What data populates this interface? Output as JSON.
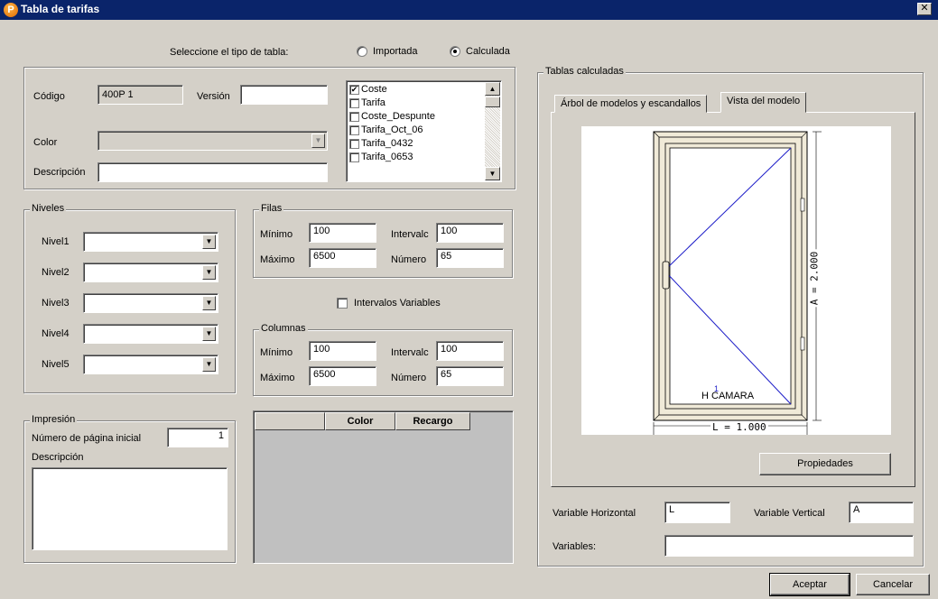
{
  "window": {
    "title": "Tabla de tarifas",
    "close": "✕"
  },
  "table_type": {
    "label": "Seleccione el tipo de tabla:",
    "options": [
      "Importada",
      "Calculada"
    ],
    "selected": "Calculada"
  },
  "header": {
    "codigo_label": "Código",
    "codigo_value": "400P 1",
    "version_label": "Versión",
    "version_value": "",
    "color_label": "Color",
    "color_value": "",
    "descripcion_label": "Descripción",
    "descripcion_value": ""
  },
  "tariffs": [
    {
      "name": "Coste",
      "checked": true
    },
    {
      "name": "Tarifa",
      "checked": false
    },
    {
      "name": "Coste_Despunte",
      "checked": false
    },
    {
      "name": "Tarifa_Oct_06",
      "checked": false
    },
    {
      "name": "Tarifa_0432",
      "checked": false
    },
    {
      "name": "Tarifa_0653",
      "checked": false
    }
  ],
  "niveles": {
    "title": "Niveles",
    "items": [
      {
        "label": "Nivel1",
        "value": ""
      },
      {
        "label": "Nivel2",
        "value": ""
      },
      {
        "label": "Nivel3",
        "value": ""
      },
      {
        "label": "Nivel4",
        "value": ""
      },
      {
        "label": "Nivel5",
        "value": ""
      }
    ]
  },
  "filas": {
    "title": "Filas",
    "minimo_label": "Mínimo",
    "minimo": "100",
    "maximo_label": "Máximo",
    "maximo": "6500",
    "intervalo_label": "Intervalc",
    "intervalo": "100",
    "numero_label": "Número",
    "numero": "65"
  },
  "intervalos_variables": {
    "label": "Intervalos Variables",
    "checked": false
  },
  "columnas": {
    "title": "Columnas",
    "minimo_label": "Mínimo",
    "minimo": "100",
    "maximo_label": "Máximo",
    "maximo": "6500",
    "intervalo_label": "Intervalc",
    "intervalo": "100",
    "numero_label": "Número",
    "numero": "65"
  },
  "impresion": {
    "title": "Impresión",
    "pagina_label": "Número de página inicial",
    "pagina_value": "1",
    "descripcion_label": "Descripción",
    "descripcion_value": ""
  },
  "recargo_grid": {
    "columns": [
      "",
      "Color",
      "Recargo"
    ]
  },
  "tablas_calculadas": {
    "title": "Tablas calculadas",
    "tabs": [
      "Árbol de modelos y escandallos",
      "Vista del modelo"
    ],
    "active_tab": "Vista del modelo",
    "drawing": {
      "width_label": "L = 1.000",
      "height_label": "A = 2.000",
      "glass_label": "H CAMARA",
      "marker": "1"
    },
    "propiedades_button": "Propiedades",
    "var_horizontal_label": "Variable Horizontal",
    "var_horizontal": "L",
    "var_vertical_label": "Variable Vertical",
    "var_vertical": "A",
    "variables_label": "Variables:",
    "variables": ""
  },
  "footer": {
    "aceptar": "Aceptar",
    "cancelar": "Cancelar"
  }
}
